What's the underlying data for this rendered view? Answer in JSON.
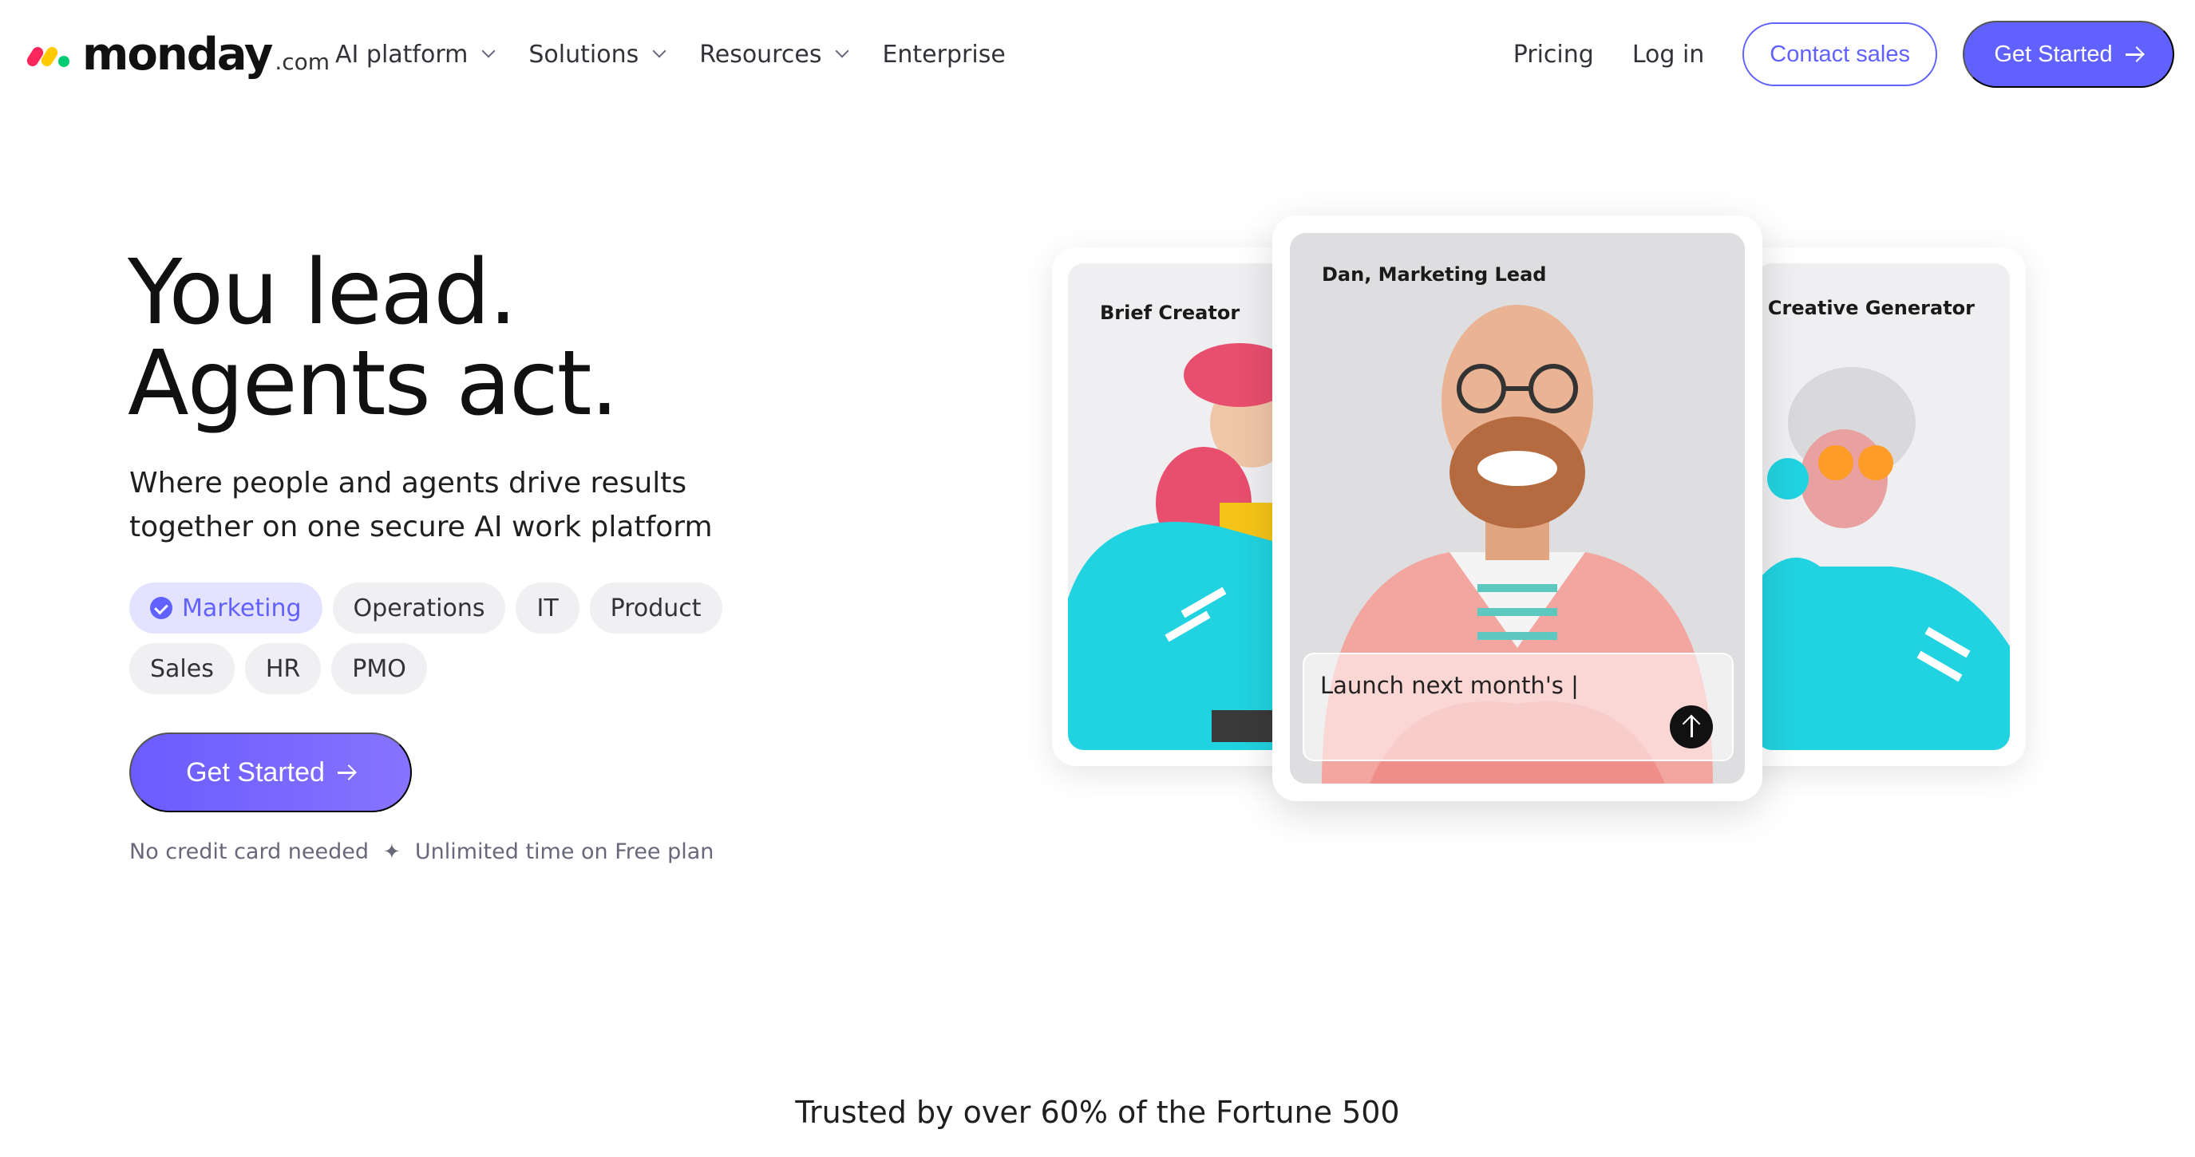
{
  "brand": {
    "name": "monday",
    "suffix": ".com"
  },
  "nav": {
    "menu": [
      {
        "label": "AI platform",
        "has_dropdown": true
      },
      {
        "label": "Solutions",
        "has_dropdown": true
      },
      {
        "label": "Resources",
        "has_dropdown": true
      },
      {
        "label": "Enterprise",
        "has_dropdown": false
      }
    ],
    "pricing": "Pricing",
    "login": "Log in",
    "contact_sales": "Contact sales",
    "get_started": "Get Started"
  },
  "hero": {
    "headline_line1": "You lead.",
    "headline_line2": "Agents act.",
    "sub_line1": "Where people and agents drive results",
    "sub_line2": "together on one secure AI work platform",
    "chips_row1": [
      "Marketing",
      "Operations",
      "IT",
      "Product"
    ],
    "chips_row2": [
      "Sales",
      "HR",
      "PMO"
    ],
    "selected_chip": "Marketing",
    "cta": "Get Started",
    "note_left": "No credit card needed",
    "note_right": "Unlimited time on Free plan"
  },
  "cards": {
    "left_label": "Brief Creator",
    "center_label": "Dan, Marketing Lead",
    "right_label": "Creative Generator",
    "prompt_text": "Launch next month's |"
  },
  "trusted": "Trusted by over 60% of the Fortune 500",
  "colors": {
    "accent": "#6161ff",
    "chip_bg": "#f0f0f3",
    "chip_active_bg": "#e4e3ff",
    "agent_teal": "#21d3e0"
  }
}
